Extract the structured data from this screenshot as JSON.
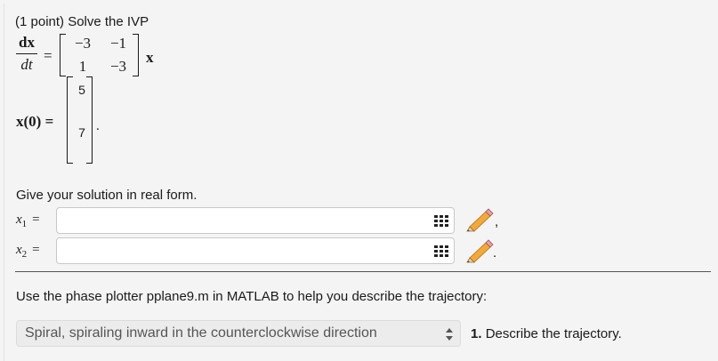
{
  "problem": {
    "points": "(1 point)",
    "title": "Solve the IVP"
  },
  "ode": {
    "lhs_num": "dx",
    "lhs_den": "dt",
    "equals": "=",
    "matrix": [
      [
        "−3",
        "−1"
      ],
      [
        "1",
        "−3"
      ]
    ],
    "vector": "x"
  },
  "initial": {
    "label": "x(0) =",
    "values": [
      "5",
      "7"
    ],
    "period": "."
  },
  "prompt": "Give your solution in real form.",
  "answers": [
    {
      "label_var": "x",
      "label_sub": "1",
      "equals": "=",
      "value": "",
      "punct": ","
    },
    {
      "label_var": "x",
      "label_sub": "2",
      "equals": "=",
      "value": "",
      "punct": "."
    }
  ],
  "phase_prompt": "Use the phase plotter pplane9.m in MATLAB to help you describe the trajectory:",
  "trajectory": {
    "selected": "Spiral, spiraling inward in the counterclockwise direction",
    "number": "1.",
    "label": "Describe the trajectory."
  },
  "icons": [
    "grid-icon",
    "pencil-icon",
    "up-down-caret-icon"
  ]
}
